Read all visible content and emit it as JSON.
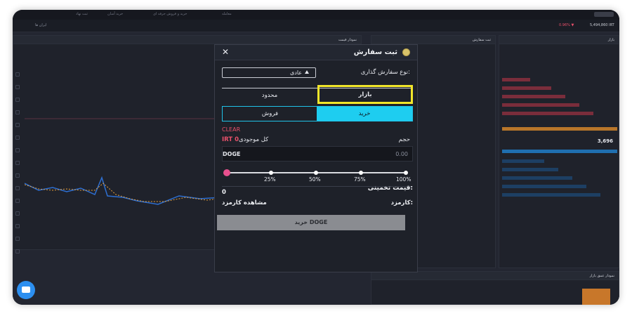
{
  "top_nav": {
    "items": [
      "ثبت نهاد",
      "خرید آسان",
      "خرید و فروش حرفه ای",
      "معامله"
    ]
  },
  "sub_nav": {
    "tab_label": "ایران ها",
    "change": "0.96% ▼",
    "price": "5,494,860 IRT"
  },
  "chart_panel": {
    "title": "نمودار قیمت"
  },
  "order_panel_bg": {
    "title": "ثبت سفارش"
  },
  "book_panel": {
    "title": "بازار",
    "mid_price": "3,696"
  },
  "depth_panel": {
    "title": "نمودار عمق بازار"
  },
  "modal": {
    "title": "ثبت سفارش",
    "order_type_label": "نوع سفارش گذاری:",
    "order_type_value": "عادی",
    "tabs": {
      "market": "بازار",
      "limit": "محدود"
    },
    "sides": {
      "buy": "خرید",
      "sell": "فروش"
    },
    "clear": "CLEAR",
    "volume_label": "حجم",
    "balance_label": "کل موجودی",
    "balance_value": "IRT 0",
    "amount_currency": "DOGE",
    "amount_value": "0.00",
    "slider": {
      "value_percent": 0,
      "marks": [
        "25%",
        "50%",
        "75%",
        "100%"
      ]
    },
    "estimate_label": "قیمت تخمینی:",
    "estimate_value": "0",
    "fee_label": "کارمزد:",
    "fee_link": "مشاهده کارمزد",
    "submit_label": "خرید DOGE"
  },
  "colors": {
    "accent_cyan": "#1ecdf0",
    "highlight_yellow": "#f2e62a",
    "danger_pink": "#e8506a",
    "submit_grey": "#8a8c91"
  },
  "icons": [
    "close-icon",
    "coin-icon",
    "caret-up-icon",
    "chat-icon"
  ]
}
